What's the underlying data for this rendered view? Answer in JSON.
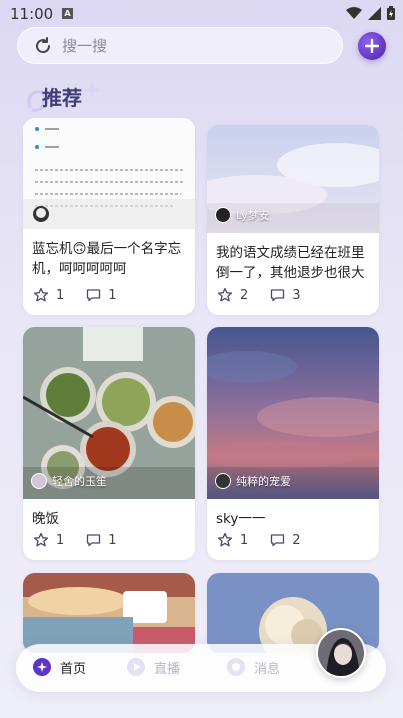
{
  "status_bar": {
    "time": "11:00",
    "notification_icon": "A"
  },
  "search": {
    "placeholder": "搜一搜"
  },
  "section": {
    "title": "推荐"
  },
  "cards": [
    {
      "caption": "蓝忘机🙃最后一个名字忘机，呵呵呵呵呵",
      "author": "",
      "likes": "1",
      "comments": "1"
    },
    {
      "caption": "我的语文成绩已经在班里倒一了，其他退步也很大",
      "author": "Ly梦安",
      "likes": "2",
      "comments": "3"
    },
    {
      "caption": "晚饭",
      "author": "轻舍的玉笙",
      "likes": "1",
      "comments": "1"
    },
    {
      "caption": "sky一一",
      "author": "纯粹的宠爱",
      "likes": "1",
      "comments": "2"
    }
  ],
  "nav": {
    "home": "首页",
    "live": "直播",
    "messages": "消息"
  },
  "colors": {
    "accent": "#5b35c8",
    "title": "#3f3d7a"
  }
}
